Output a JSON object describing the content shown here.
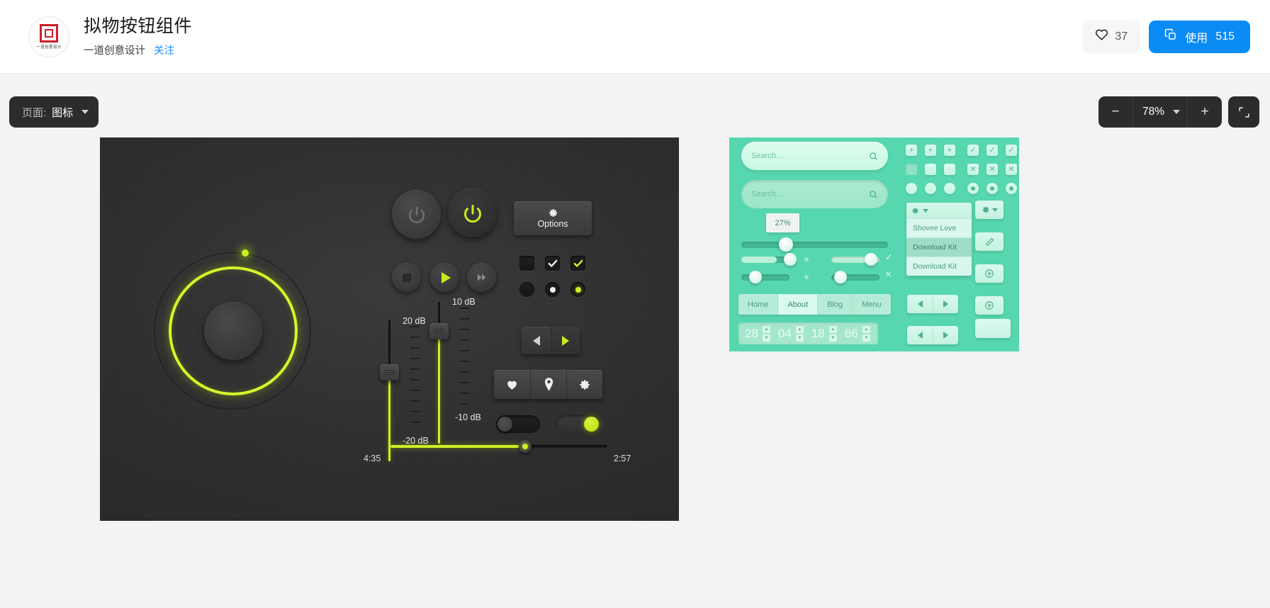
{
  "header": {
    "title": "拟物按钮组件",
    "author": "一道创意设计",
    "follow_label": "关注",
    "avatar_text": "一道创意设计",
    "like_count": "37",
    "use_label": "使用",
    "use_count": "515"
  },
  "toolbar": {
    "page_label": "页面:",
    "page_value": "图标",
    "zoom_minus": "−",
    "zoom_value": "78%",
    "zoom_plus": "+"
  },
  "dark_panel": {
    "options_label": "Options",
    "sliders": [
      {
        "label": "20 dB"
      },
      {
        "label": "10 dB"
      },
      {
        "label": "-10 dB"
      },
      {
        "label": "-20 dB"
      }
    ],
    "time_start": "4:35",
    "time_end": "2:57"
  },
  "mint_panel": {
    "search_a_placeholder": "Search...",
    "search_b_placeholder": "Search...",
    "tooltip_value": "27%",
    "dropdown": {
      "items": [
        {
          "label": "Shovee Love",
          "selected": false
        },
        {
          "label": "Download Kit",
          "selected": true
        },
        {
          "label": "Download Kit",
          "selected": false
        }
      ]
    },
    "nav": [
      {
        "label": "Home",
        "active": false
      },
      {
        "label": "About",
        "active": true
      },
      {
        "label": "Blog",
        "active": false
      },
      {
        "label": "Menu",
        "active": false
      }
    ],
    "stepper": [
      "28",
      "04",
      "18",
      "86"
    ],
    "stepper_up": "▲",
    "stepper_down": "▼",
    "check_glyph": "✓",
    "cross_glyph": "✕"
  },
  "colors": {
    "accent_blue": "#0a8bf5",
    "accent_green": "#cdf024",
    "mint": "#57d7b0",
    "dark": "#2e2e2e"
  }
}
